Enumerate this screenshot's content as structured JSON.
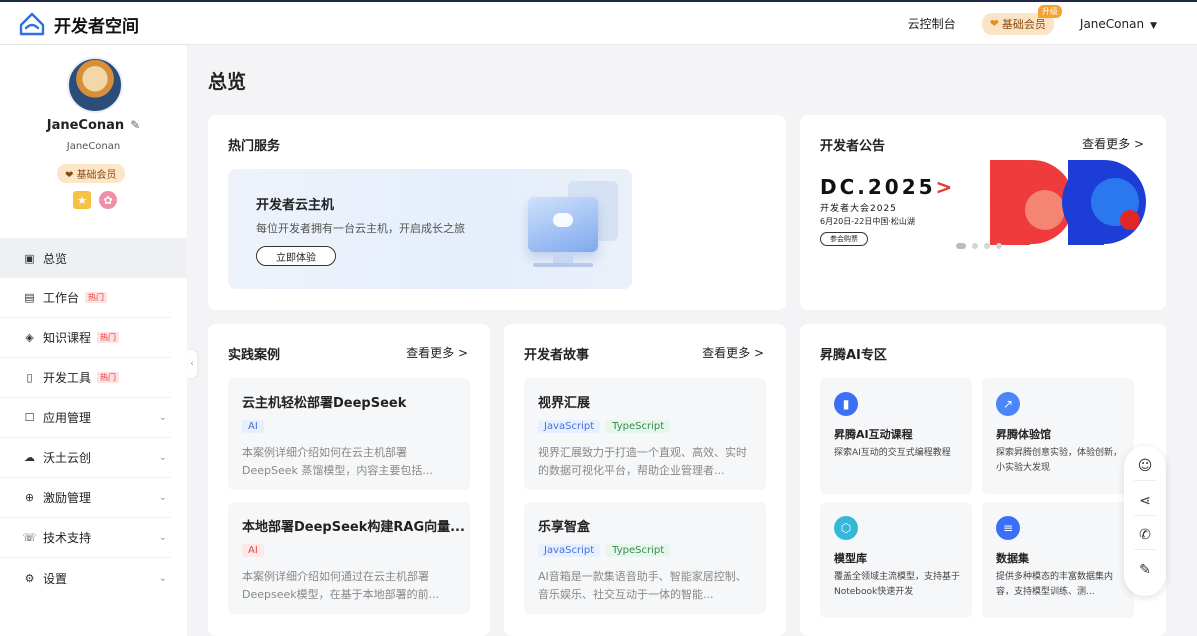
{
  "header": {
    "logo_text": "开发者空间",
    "console_link": "云控制台",
    "vip_label": "基础会员",
    "upgrade_tag": "升级",
    "username": "JaneConan"
  },
  "profile": {
    "name": "JaneConan",
    "sub_name": "JaneConan",
    "badge": "基础会员"
  },
  "nav": {
    "items": [
      {
        "label": "总览",
        "icon": "dashboard-icon",
        "hot": "",
        "active": true
      },
      {
        "label": "工作台",
        "icon": "workbench-icon",
        "hot": "热门"
      },
      {
        "label": "知识课程",
        "icon": "course-icon",
        "hot": "热门"
      },
      {
        "label": "开发工具",
        "icon": "tools-icon",
        "hot": "热门"
      },
      {
        "label": "应用管理",
        "icon": "app-icon",
        "hot": ""
      },
      {
        "label": "沃土云创",
        "icon": "cloud-icon",
        "hot": ""
      },
      {
        "label": "激励管理",
        "icon": "gift-icon",
        "hot": ""
      },
      {
        "label": "技术支持",
        "icon": "support-icon",
        "hot": ""
      },
      {
        "label": "设置",
        "icon": "settings-icon",
        "hot": ""
      }
    ]
  },
  "main": {
    "page_title": "总览",
    "hot_services": {
      "title": "热门服务",
      "hero_title": "开发者云主机",
      "hero_desc": "每位开发者拥有一台云主机，开启成长之旅",
      "hero_button": "立即体验"
    },
    "notice": {
      "title": "开发者公告",
      "more": "查看更多 >",
      "banner_main": "DC.2025",
      "banner_sub": "开发者大会2025",
      "banner_date": "6月20日-22日中国·松山湖",
      "banner_button": "参会购票"
    },
    "cases": {
      "title": "实践案例",
      "more": "查看更多 >",
      "items": [
        {
          "title": "云主机轻松部署DeepSeek",
          "tag": "AI",
          "desc": "本案例详细介绍如何在云主机部署DeepSeek 蒸馏模型，内容主要包括..."
        },
        {
          "title": "本地部署DeepSeek构建RAG向量...",
          "tag": "AI",
          "desc": "本案例详细介绍如何通过在云主机部署Deepseek模型，在基于本地部署的前..."
        }
      ]
    },
    "stories": {
      "title": "开发者故事",
      "more": "查看更多 >",
      "items": [
        {
          "title": "视界汇展",
          "tag1": "JavaScript",
          "tag2": "TypeScript",
          "desc": "视界汇展致力于打造一个直观、高效、实时的数据可视化平台，帮助企业管理者..."
        },
        {
          "title": "乐享智盒",
          "tag1": "JavaScript",
          "tag2": "TypeScript",
          "desc": "AI音箱是一款集语音助手、智能家居控制、音乐娱乐、社交互动于一体的智能..."
        }
      ]
    },
    "ai_zone": {
      "title": "昇腾AI专区",
      "items": [
        {
          "title": "昇腾AI互动课程",
          "desc": "探索AI互动的交互式编程教程",
          "icon": "book-icon",
          "color": "#3b6ff5"
        },
        {
          "title": "昇腾体验馆",
          "desc": "探索昇腾创意实验，体验创新，小实验大发现",
          "icon": "wand-icon",
          "color": "#4a86f7"
        },
        {
          "title": "模型库",
          "desc": "覆盖全领域主流模型，支持基于Notebook快速开发",
          "icon": "cube-icon",
          "color": "#34b7d8"
        },
        {
          "title": "数据集",
          "desc": "提供多种模态的丰富数据集内容，支持模型训练、测...",
          "icon": "database-icon",
          "color": "#3b6ff5"
        }
      ]
    }
  },
  "float_toolbar": [
    "smile-icon",
    "share-icon",
    "phone-icon",
    "feedback-icon"
  ]
}
